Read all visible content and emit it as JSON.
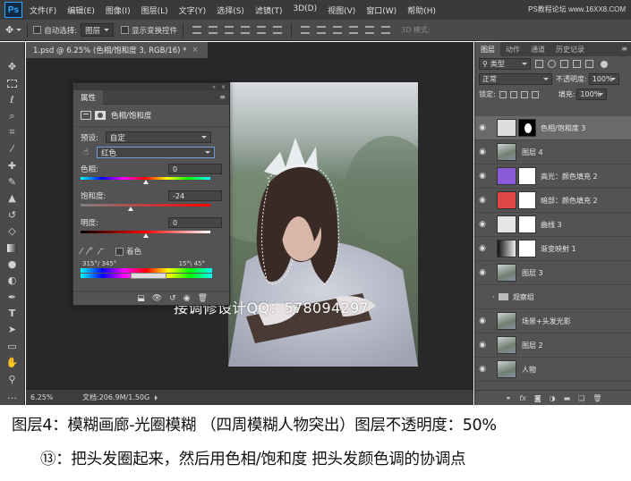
{
  "app": {
    "logo": "Ps"
  },
  "menu": [
    "文件(F)",
    "编辑(E)",
    "图像(I)",
    "图层(L)",
    "文字(Y)",
    "选择(S)",
    "滤镜(T)",
    "3D(D)",
    "视图(V)",
    "窗口(W)",
    "帮助(H)"
  ],
  "watermark_top": "PS教程论坛 www.16XX8.COM",
  "options": {
    "auto_select_label": "自动选择:",
    "auto_select_value": "图层",
    "show_transform_label": "显示变换控件",
    "mode_3d": "3D 模式:"
  },
  "document": {
    "tab_title": "1.psd @ 6.25% (色相/饱和度 3, RGB/16) *",
    "zoom": "6.25%",
    "doc_info": "文档:206.9M/1.50G"
  },
  "overlay_watermark": "接调修设计QQ：578094297",
  "properties": {
    "tab": "属性",
    "adjustment_title": "色相/饱和度",
    "preset_label": "预设:",
    "preset_value": "自定",
    "channel_value": "红色",
    "hue_label": "色相:",
    "hue_value": "0",
    "saturation_label": "饱和度:",
    "saturation_value": "-24",
    "lightness_label": "明度:",
    "lightness_value": "0",
    "colorize_label": "着色",
    "range_left": "315°/ 345°",
    "range_right": "15°\\ 45°"
  },
  "layers_panel": {
    "tabs": [
      "图层",
      "动作",
      "通道",
      "历史记录"
    ],
    "filter_value": "类型",
    "blend_mode": "正常",
    "opacity_label": "不透明度:",
    "opacity_value": "100%",
    "lock_label": "锁定:",
    "fill_label": "填充:",
    "fill_value": "100%",
    "layers": [
      {
        "name": "色相/饱和度 3",
        "visible": true,
        "active": true,
        "thumb": "adjust",
        "mask": "hair"
      },
      {
        "name": "图层 4",
        "visible": true,
        "thumb": "photo"
      },
      {
        "name": "高光：颜色填充 2",
        "visible": true,
        "thumb": "#8a5ad8",
        "mask": "white"
      },
      {
        "name": "暗部：颜色填充 2",
        "visible": true,
        "thumb": "#e04848",
        "mask": "white"
      },
      {
        "name": "曲线 3",
        "visible": true,
        "thumb": "curve",
        "mask": "white"
      },
      {
        "name": "渐变映射 1",
        "visible": true,
        "thumb": "gradient",
        "mask": "white"
      },
      {
        "name": "图层 3",
        "visible": true,
        "thumb": "photo"
      },
      {
        "name": "观察组",
        "visible": false,
        "group": true
      },
      {
        "name": "场景+头发光影",
        "visible": true,
        "thumb": "photo"
      },
      {
        "name": "图层 2",
        "visible": true,
        "thumb": "photo"
      },
      {
        "name": "人物",
        "visible": true,
        "thumb": "photo"
      }
    ]
  },
  "captions": {
    "line1": "图层4：模糊画廊-光圈模糊 （四周模糊人物突出）图层不透明度：50%",
    "line2": "⑬：把头发圈起来，然后用色相/饱和度 把头发颜色调的协调点"
  }
}
